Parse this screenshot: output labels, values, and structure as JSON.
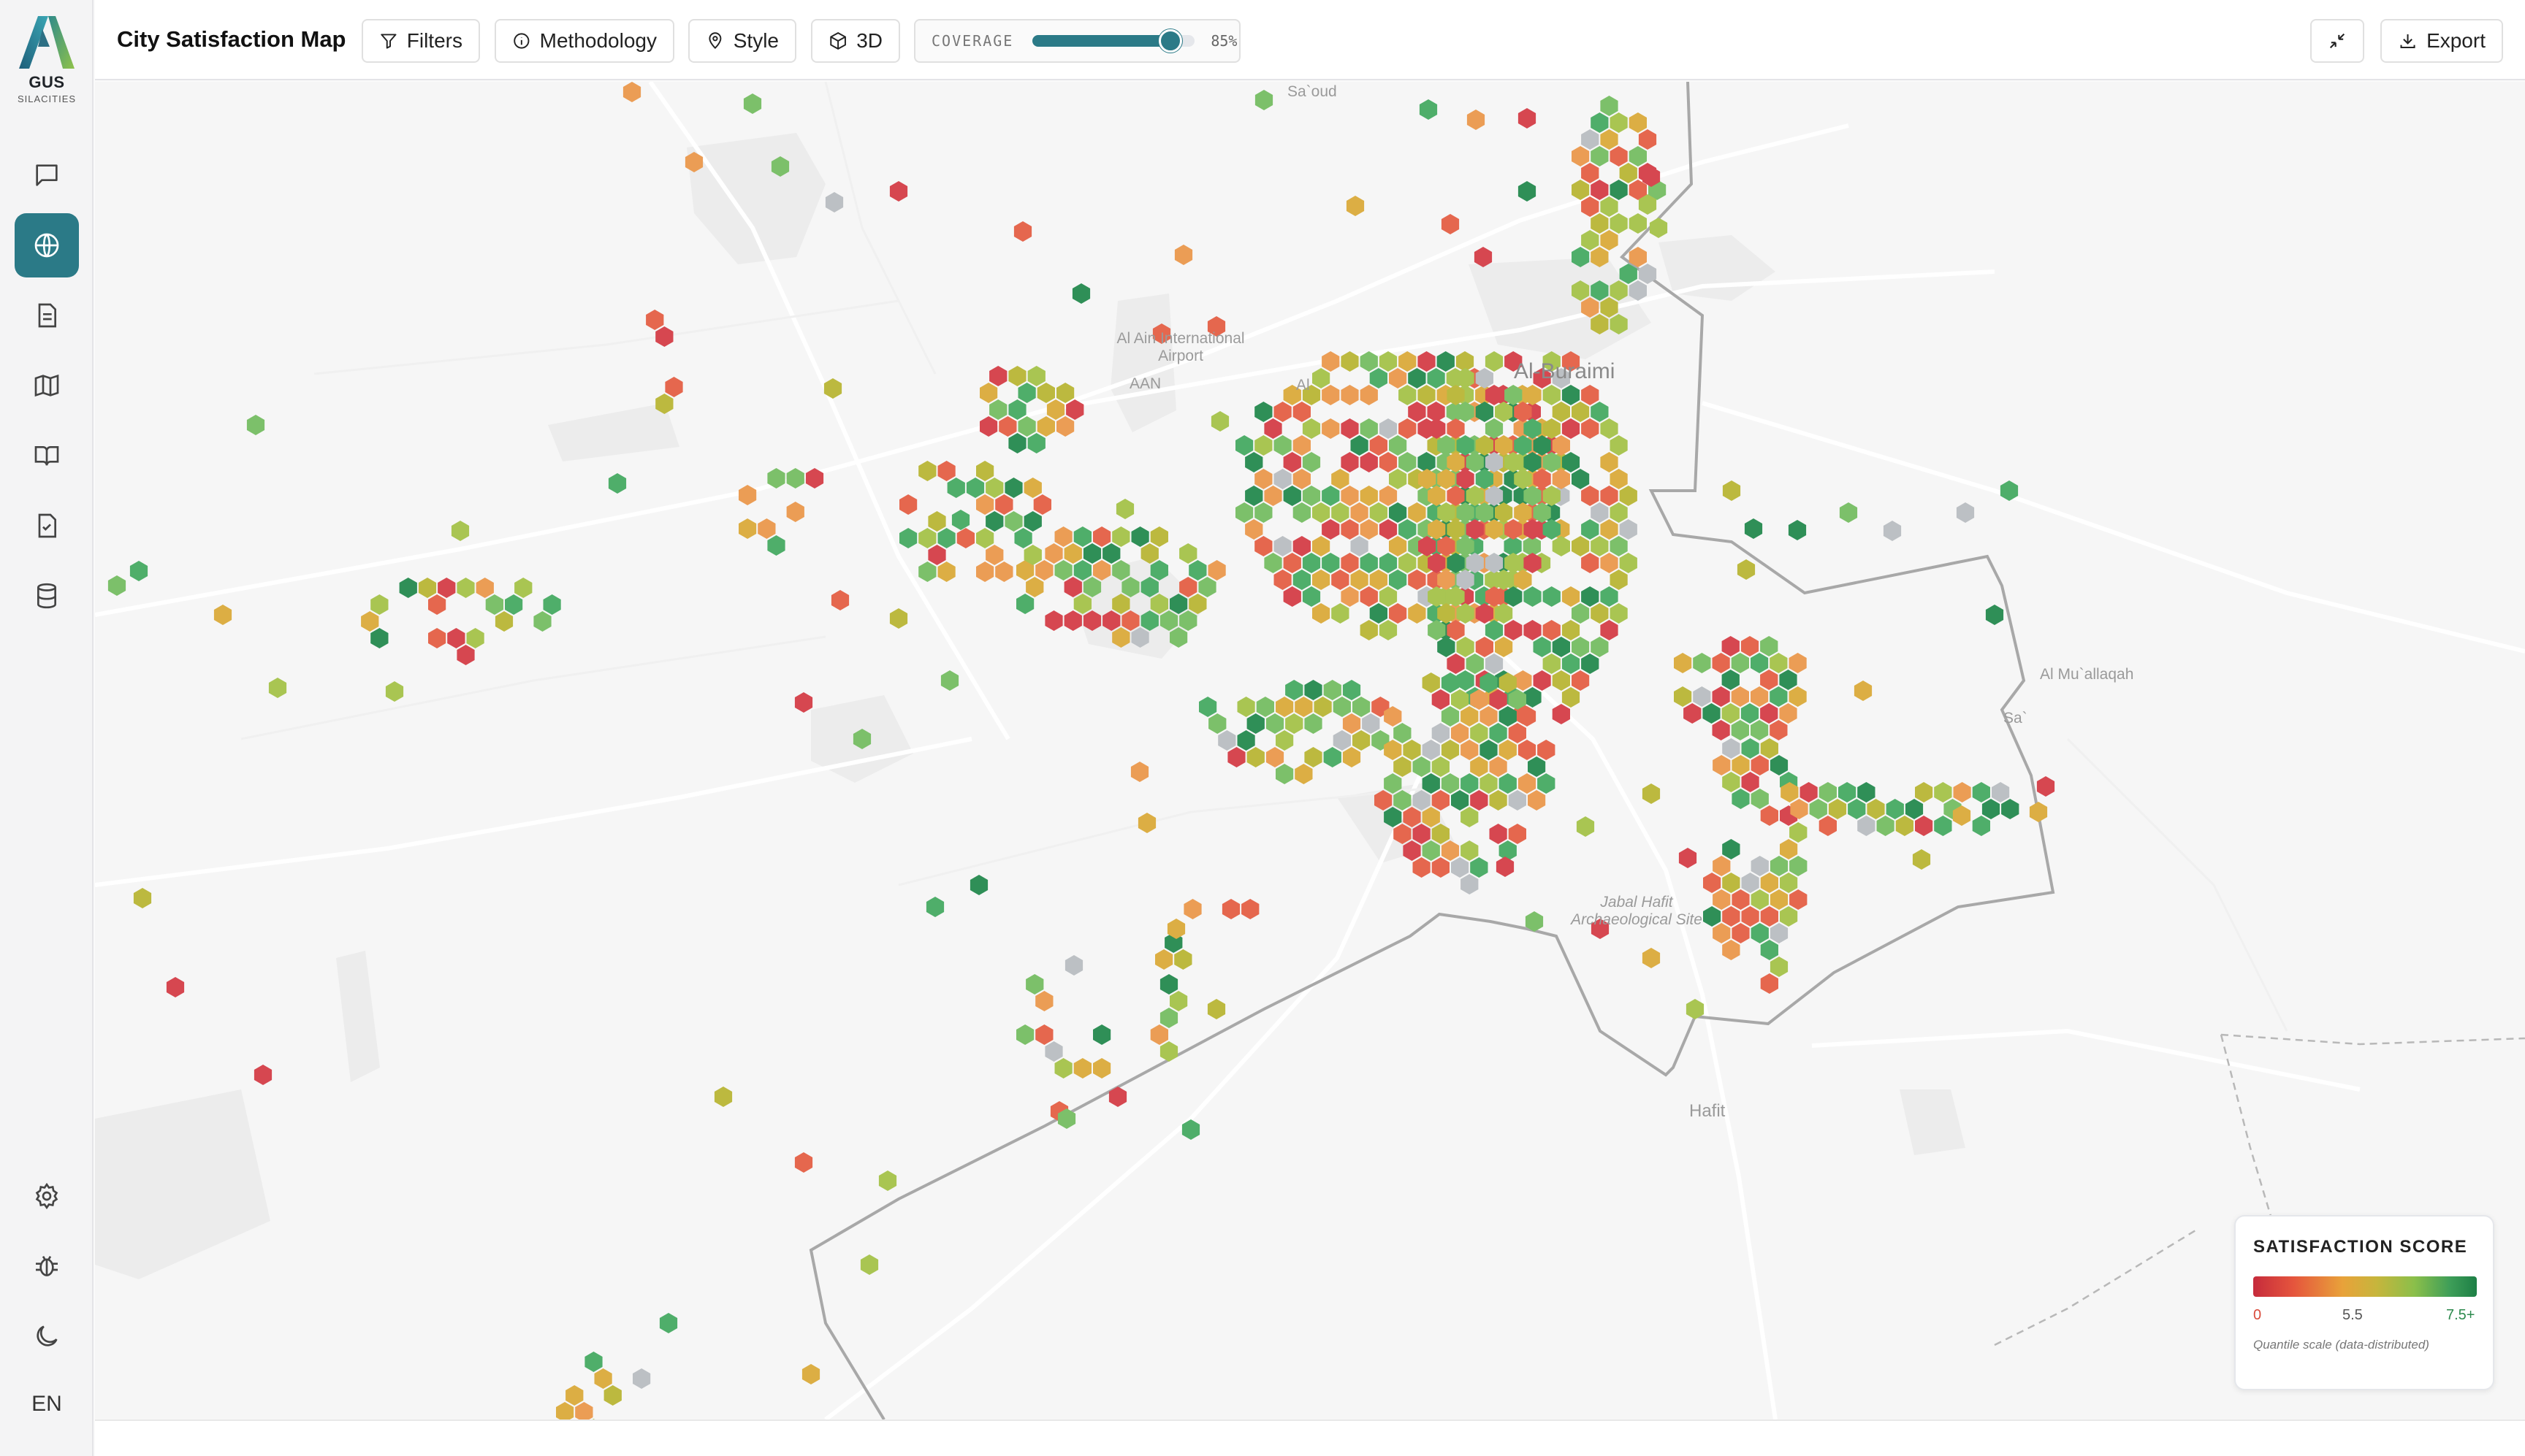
{
  "brand": {
    "name": "GUS",
    "subtitle": "SILACITIES"
  },
  "header": {
    "title": "City Satisfaction Map",
    "buttons": {
      "filters": "Filters",
      "methodology": "Methodology",
      "style": "Style",
      "view3d": "3D",
      "export": "Export"
    },
    "coverage": {
      "label": "COVERAGE",
      "value_text": "85%",
      "value": 0.85
    }
  },
  "sidebar": {
    "items": [
      {
        "icon": "chat-icon"
      },
      {
        "icon": "globe-icon",
        "active": true
      },
      {
        "icon": "document-icon"
      },
      {
        "icon": "map-icon"
      },
      {
        "icon": "book-icon"
      },
      {
        "icon": "checklist-icon"
      },
      {
        "icon": "database-icon"
      }
    ],
    "bottom": [
      {
        "icon": "gear-icon"
      },
      {
        "icon": "bug-icon"
      },
      {
        "icon": "moon-icon"
      }
    ],
    "language": "EN"
  },
  "map": {
    "places": {
      "saoud": "Sa`oud",
      "airport_line1": "Al Ain International",
      "airport_line2": "Airport",
      "airport_code": "AAN",
      "al": "Al",
      "buraimi": "Al-Buraimi",
      "mullaqah": "Al Mu`allaqah",
      "sa": "Sa`",
      "jabal_line1": "Jabal Hafit",
      "jabal_line2": "Archaeological Site",
      "hafit": "Hafit"
    },
    "hex_colors": {
      "red": "#d64750",
      "red_orange": "#e5674e",
      "orange": "#eb9d55",
      "amber": "#dcae44",
      "olive": "#bcb93f",
      "yellow_green": "#a9c552",
      "light_green": "#7cc06a",
      "green": "#4fae6a",
      "dark_green": "#2f8f57",
      "no_data": "#bcc0c4"
    }
  },
  "legend": {
    "title": "SATISFACTION SCORE",
    "min_label": "0",
    "mid_label": "5.5",
    "max_label": "7.5+",
    "note": "Quantile scale (data-distributed)",
    "colors": {
      "min": "#d94a3a",
      "mid": "#555555",
      "max": "#2d8a4e"
    }
  }
}
